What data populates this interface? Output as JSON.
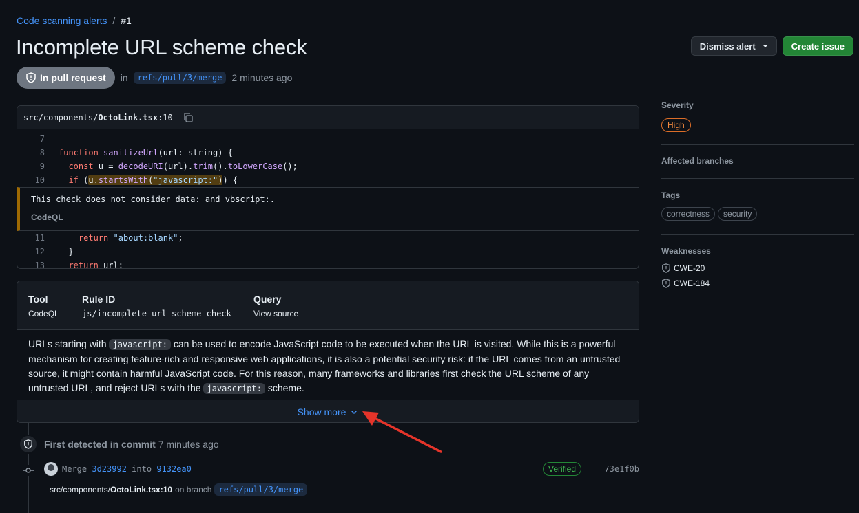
{
  "breadcrumb": {
    "parent": "Code scanning alerts",
    "sep": "/",
    "current": "#1"
  },
  "title": "Incomplete URL scheme check",
  "actions": {
    "dismiss": "Dismiss alert",
    "create": "Create issue"
  },
  "meta": {
    "state": "In pull request",
    "in": "in",
    "branch": "refs/pull/3/merge",
    "ago": "2 minutes ago"
  },
  "code": {
    "path_prefix": "src/components/",
    "file": "OctoLink.tsx",
    "line_ref": ":10",
    "lines_before": [
      {
        "n": "7"
      },
      {
        "n": "8"
      },
      {
        "n": "9"
      },
      {
        "n": "10"
      }
    ],
    "message": "This check does not consider data: and vbscript:.",
    "source": "CodeQL",
    "lines_after": [
      {
        "n": "11"
      },
      {
        "n": "12"
      },
      {
        "n": "13"
      }
    ]
  },
  "info": {
    "tool_h": "Tool",
    "tool_v": "CodeQL",
    "rule_h": "Rule ID",
    "rule_v": "js/incomplete-url-scheme-check",
    "query_h": "Query",
    "query_v": "View source",
    "desc_1": "URLs starting with ",
    "code_1": "javascript:",
    "desc_2": " can be used to encode JavaScript code to be executed when the URL is visited. While this is a powerful mechanism for creating feature-rich and responsive web applications, it is also a potential security risk: if the URL comes from an untrusted source, it might contain harmful JavaScript code. For this reason, many frameworks and libraries first check the URL scheme of any untrusted URL, and reject URLs with the ",
    "code_2": "javascript:",
    "desc_3": " scheme.",
    "show_more": "Show more"
  },
  "timeline": {
    "first_detected": "First detected in commit",
    "ago": "7 minutes ago",
    "merge": "Merge",
    "sha1": "3d23992",
    "into": "into",
    "sha2": "9132ea0",
    "verified": "Verified",
    "right_sha": "73e1f0b",
    "loc_prefix": "src/components/",
    "loc_file": "OctoLink.tsx:10",
    "on_branch": "on branch",
    "branch": "refs/pull/3/merge"
  },
  "sidebar": {
    "severity_h": "Severity",
    "severity": "High",
    "branches_h": "Affected branches",
    "tags_h": "Tags",
    "tags": [
      "correctness",
      "security"
    ],
    "weak_h": "Weaknesses",
    "weaknesses": [
      "CWE-20",
      "CWE-184"
    ]
  },
  "colors": {
    "accent": "#4493f8",
    "primary_btn": "#238636",
    "severity": "#f0883e",
    "highlight": "#bb8009",
    "annotation": "#e5342a"
  }
}
